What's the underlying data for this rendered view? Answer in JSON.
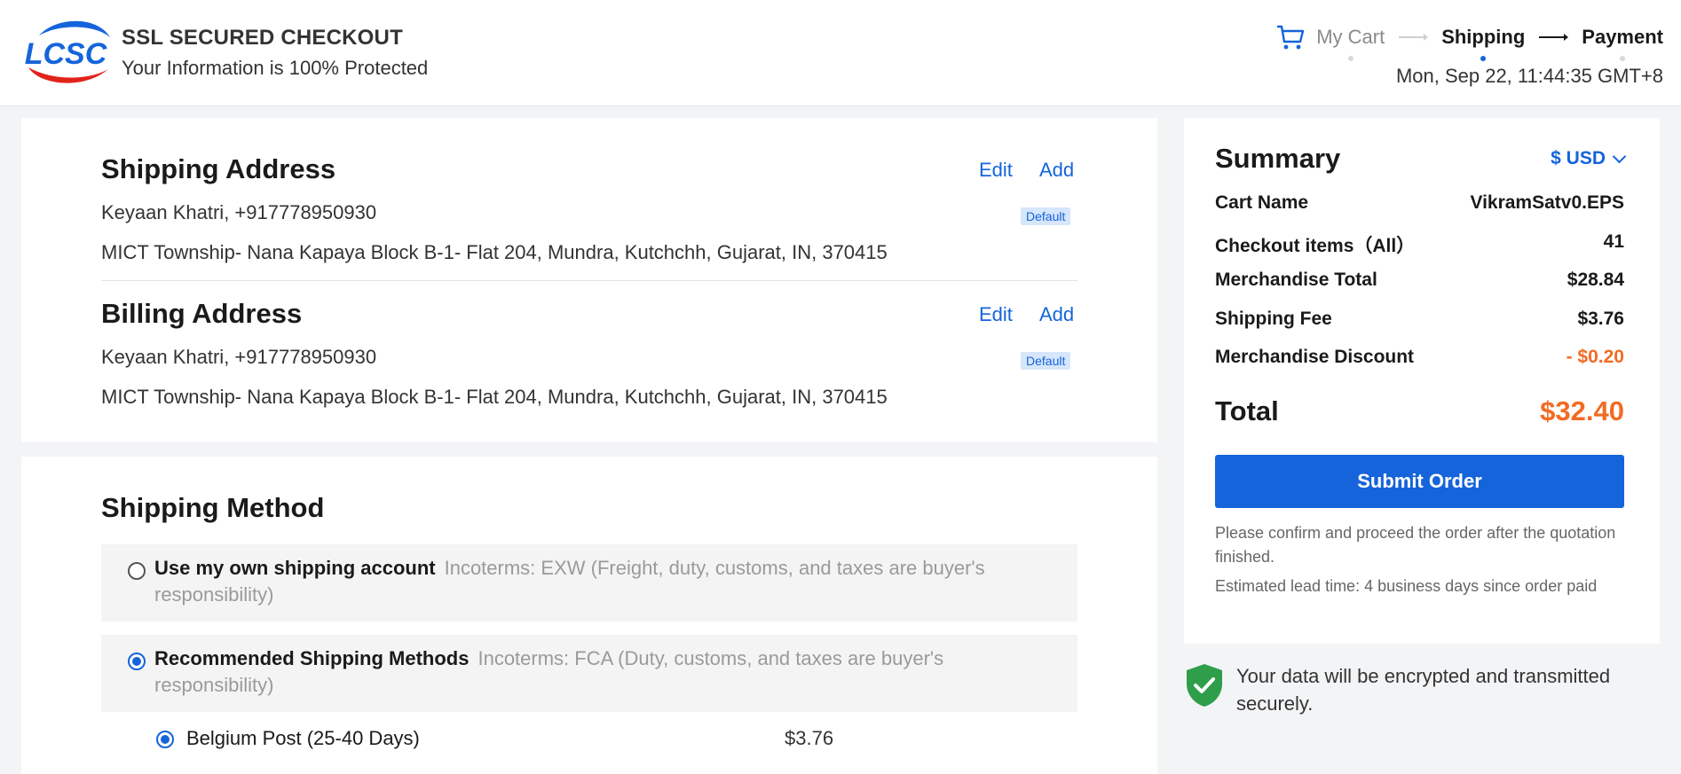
{
  "header": {
    "brand_title": "SSL SECURED CHECKOUT",
    "brand_subtitle": "Your Information is 100% Protected",
    "logo_text": "LCSC",
    "steps": [
      {
        "label": "My Cart",
        "state": "done"
      },
      {
        "label": "Shipping",
        "state": "active"
      },
      {
        "label": "Payment",
        "state": "upcoming"
      }
    ],
    "timestamp": "Mon, Sep 22, 11:44:35 GMT+8"
  },
  "shipping_address": {
    "title": "Shipping Address",
    "edit_label": "Edit",
    "add_label": "Add",
    "name_phone": "Keyaan Khatri, +917778950930",
    "badge": "Default",
    "address": "MICT Township- Nana Kapaya Block B-1- Flat 204, Mundra, Kutchchh, Gujarat, IN, 370415"
  },
  "billing_address": {
    "title": "Billing Address",
    "edit_label": "Edit",
    "add_label": "Add",
    "name_phone": "Keyaan Khatri, +917778950930",
    "badge": "Default",
    "address": "MICT Township- Nana Kapaya Block B-1- Flat 204, Mundra, Kutchchh, Gujarat, IN, 370415"
  },
  "shipping_method": {
    "title": "Shipping Method",
    "options": [
      {
        "label": "Use my own shipping account",
        "desc": "Incoterms: EXW (Freight, duty, customs, and taxes are buyer's responsibility)",
        "checked": false
      },
      {
        "label": "Recommended Shipping Methods",
        "desc": "Incoterms: FCA (Duty, customs, and taxes are buyer's responsibility)",
        "checked": true
      }
    ],
    "sub_option": {
      "label": "Belgium Post (25-40 Days)",
      "price": "$3.76",
      "checked": true
    }
  },
  "summary": {
    "title": "Summary",
    "currency": "$ USD",
    "rows": [
      {
        "label": "Cart Name",
        "value": "VikramSatv0.EPS"
      },
      {
        "label": "Checkout items（All）",
        "value": "41"
      },
      {
        "label": "Merchandise Total",
        "value": "$28.84"
      },
      {
        "label": "Shipping Fee",
        "value": "$3.76"
      },
      {
        "label": "Merchandise Discount",
        "value": "- $0.20"
      }
    ],
    "total_label": "Total",
    "total_value": "$32.40",
    "submit_label": "Submit Order",
    "note1": "Please confirm and proceed the order after the quotation finished.",
    "note2": "Estimated lead time: 4 business days since order paid"
  },
  "secure_note": "Your data will be encrypted and transmitted securely.",
  "colors": {
    "accent": "#1564db",
    "discount": "#f26b23",
    "shield": "#2e9e4a",
    "logo_red": "#e2231a"
  }
}
